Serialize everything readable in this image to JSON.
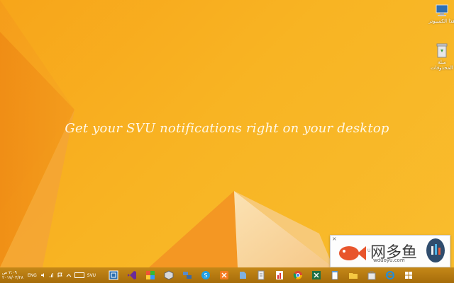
{
  "desktop": {
    "headline": "Get your SVU notifications right on your desktop",
    "icons": [
      {
        "label": "هذا الكمبيوتر",
        "icon": "computer-icon"
      },
      {
        "label": "سلة المحذوفات",
        "icon": "recycle-bin-icon"
      }
    ]
  },
  "toast": {
    "close": "×",
    "label": "U",
    "watermark_brand": "网多鱼",
    "watermark_url": "wduoyu.com"
  },
  "taskbar": {
    "clock_time": "٢:٠٩ ص",
    "clock_date": "٢٠١٧/٠٣/٢٨",
    "language": "ENG",
    "keyboard_label": "SVU",
    "apps": [
      "taskview-icon",
      "visual-studio-icon",
      "colorful-app-icon",
      "box-app-icon",
      "network-app-icon",
      "skype-icon",
      "xampp-icon",
      "paper-icon",
      "document-icon",
      "chart-app-icon",
      "chrome-icon",
      "excel-icon",
      "notepad-icon",
      "folder-icon",
      "store-icon",
      "ie-icon",
      "windows-store-icon"
    ]
  },
  "colors": {
    "wallpaper_base": "#f8b423",
    "wallpaper_dark": "#f08a10",
    "taskbar": "#b5780f"
  }
}
